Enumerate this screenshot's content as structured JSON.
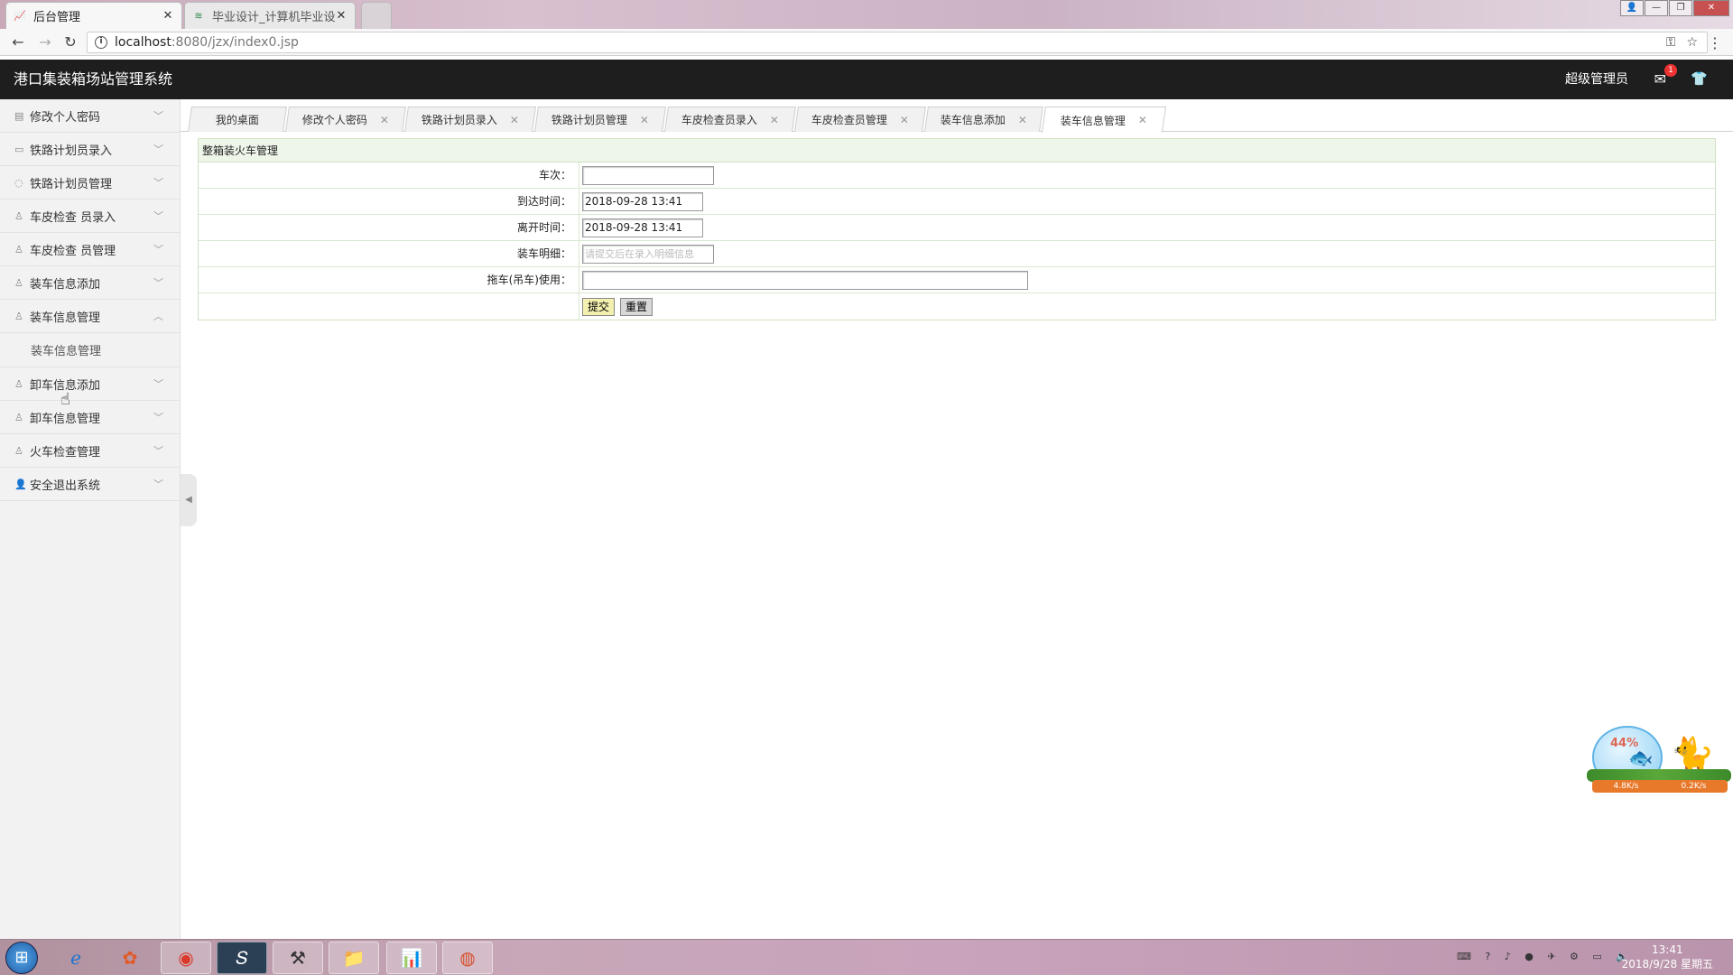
{
  "browser": {
    "tabs": [
      {
        "title": "后台管理",
        "active": true
      },
      {
        "title": "毕业设计_计算机毕业设计",
        "active": false
      }
    ],
    "url_host": "localhost",
    "url_path": ":8080/jzx/index0.jsp"
  },
  "header": {
    "title": "港口集装箱场站管理系统",
    "admin_label": "超级管理员",
    "mail_count": "1"
  },
  "sidebar": {
    "items": [
      {
        "label": "修改个人密码",
        "icon": "document-icon",
        "expanded": false
      },
      {
        "label": "铁路计划员录入",
        "icon": "card-icon",
        "expanded": false
      },
      {
        "label": "铁路计划员管理",
        "icon": "chat-icon",
        "expanded": false
      },
      {
        "label": "车皮检查 员录入",
        "icon": "user-icon",
        "expanded": false
      },
      {
        "label": "车皮检查 员管理",
        "icon": "user-icon",
        "expanded": false
      },
      {
        "label": "装车信息添加",
        "icon": "user-icon",
        "expanded": false
      },
      {
        "label": "装车信息管理",
        "icon": "user-icon",
        "expanded": true
      },
      {
        "label": "卸车信息添加",
        "icon": "user-icon",
        "expanded": false
      },
      {
        "label": "卸车信息管理",
        "icon": "user-icon",
        "expanded": false
      },
      {
        "label": "火车检查管理",
        "icon": "user-icon",
        "expanded": false
      },
      {
        "label": "安全退出系统",
        "icon": "person-icon",
        "expanded": false
      }
    ],
    "submenu_label": "装车信息管理"
  },
  "content_tabs": [
    {
      "label": "我的桌面",
      "closable": false,
      "active": false
    },
    {
      "label": "修改个人密码",
      "closable": true,
      "active": false
    },
    {
      "label": "铁路计划员录入",
      "closable": true,
      "active": false
    },
    {
      "label": "铁路计划员管理",
      "closable": true,
      "active": false
    },
    {
      "label": "车皮检查员录入",
      "closable": true,
      "active": false
    },
    {
      "label": "车皮检查员管理",
      "closable": true,
      "active": false
    },
    {
      "label": "装车信息添加",
      "closable": true,
      "active": false
    },
    {
      "label": "装车信息管理",
      "closable": true,
      "active": true
    }
  ],
  "form": {
    "heading": "整箱装火车管理",
    "fields": {
      "train_no": {
        "label": "车次：",
        "value": ""
      },
      "arrive_time": {
        "label": "到达时间：",
        "value": "2018-09-28 13:41"
      },
      "depart_time": {
        "label": "离开时间：",
        "value": "2018-09-28 13:41"
      },
      "detail": {
        "label": "装车明细：",
        "placeholder": "请提交后在录入明细信息"
      },
      "tractor": {
        "label": "拖车(吊车)使用：",
        "value": ""
      }
    },
    "submit_label": "提交",
    "reset_label": "重置"
  },
  "widget": {
    "percent": "44%",
    "upload_speed": "4.8K/s",
    "download_speed": "0.2K/s"
  },
  "taskbar": {
    "time": "13:41",
    "date": "2018/9/28 星期五"
  }
}
